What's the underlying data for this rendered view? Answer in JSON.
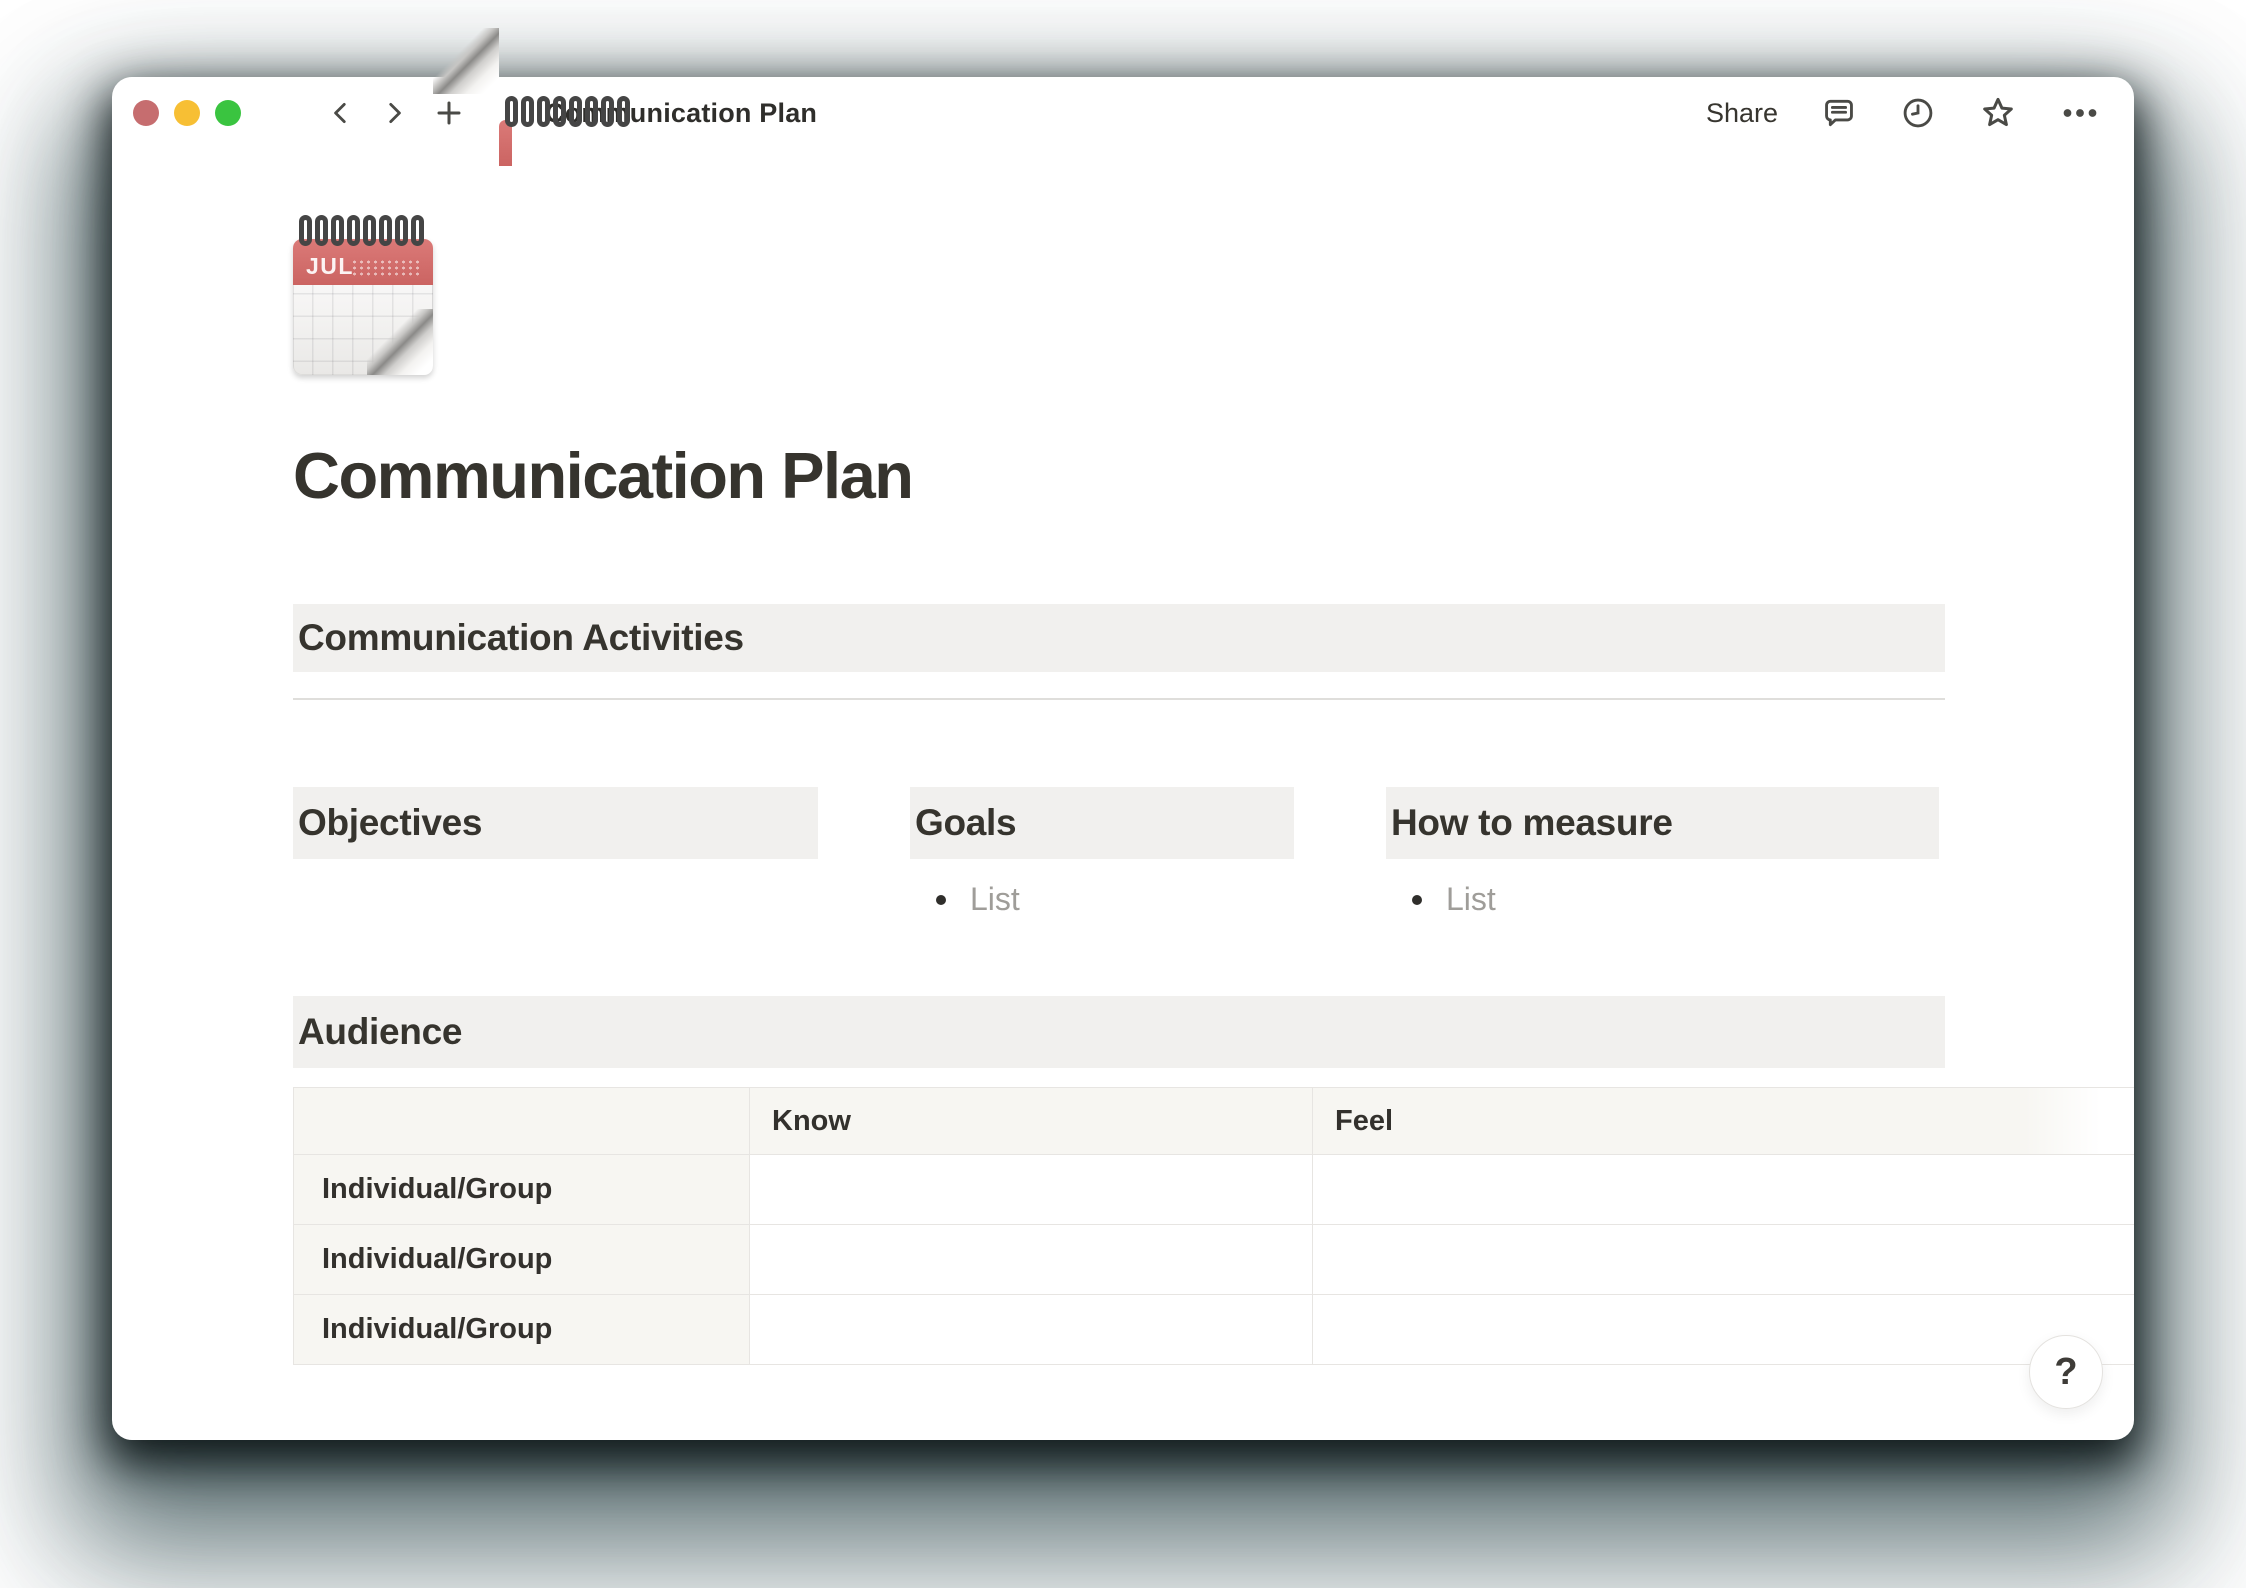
{
  "toolbar": {
    "doc_title": "Communication Plan",
    "share_label": "Share"
  },
  "page": {
    "icon": {
      "month": "JUL"
    },
    "title": "Communication Plan",
    "activities_heading": "Communication Activities",
    "columns": [
      {
        "heading": "Objectives"
      },
      {
        "heading": "Goals",
        "list": [
          "List"
        ]
      },
      {
        "heading": "How to measure",
        "list": [
          "List"
        ]
      }
    ],
    "audience": {
      "heading": "Audience",
      "table": {
        "headers": [
          "",
          "Know",
          "Feel"
        ],
        "rows": [
          {
            "label": "Individual/Group",
            "cells": [
              "",
              ""
            ]
          },
          {
            "label": "Individual/Group",
            "cells": [
              "",
              ""
            ]
          },
          {
            "label": "Individual/Group",
            "cells": [
              "",
              ""
            ]
          }
        ]
      }
    }
  },
  "help_button": {
    "label": "?"
  },
  "colors": {
    "traffic_red": "#c66d6f",
    "traffic_yellow": "#f7bf34",
    "traffic_green": "#3ac440",
    "heading_bg": "#f1f0ee",
    "table_header_bg": "#f7f6f2",
    "table_border": "#e7e5e2",
    "calendar_red": "#cf6a68",
    "text_primary": "#37352f",
    "text_muted": "#9f9d99"
  }
}
